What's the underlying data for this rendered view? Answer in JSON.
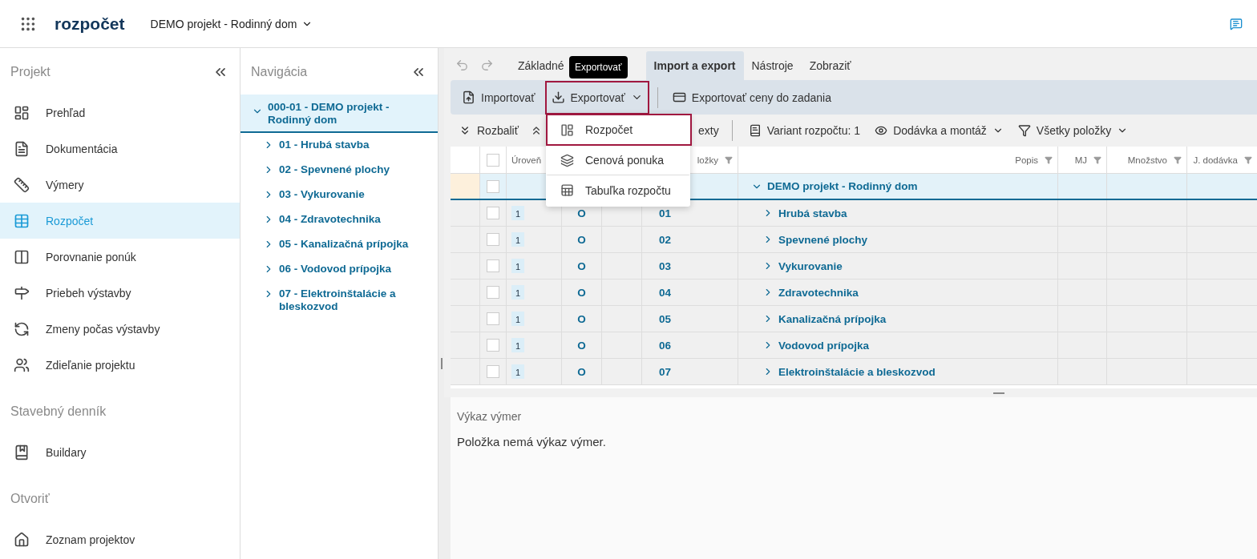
{
  "header": {
    "logo": "rozpočet",
    "project": "DEMO projekt - Rodinný dom"
  },
  "sidebar": {
    "sections": [
      {
        "title": "Projekt",
        "items": [
          {
            "label": "Prehľad",
            "selected": false
          },
          {
            "label": "Dokumentácia",
            "selected": false
          },
          {
            "label": "Výmery",
            "selected": false
          },
          {
            "label": "Rozpočet",
            "selected": true
          },
          {
            "label": "Porovnanie ponúk",
            "selected": false
          },
          {
            "label": "Priebeh výstavby",
            "selected": false
          },
          {
            "label": "Zmeny počas výstavby",
            "selected": false
          },
          {
            "label": "Zdieľanie projektu",
            "selected": false
          }
        ]
      },
      {
        "title": "Stavebný denník",
        "items": [
          {
            "label": "Buildary",
            "selected": false
          }
        ]
      },
      {
        "title": "Otvoriť",
        "items": [
          {
            "label": "Zoznam projektov",
            "selected": false
          }
        ]
      }
    ]
  },
  "navigation": {
    "title": "Navigácia",
    "tree": [
      {
        "label": "000-01 - DEMO projekt - Rodinný dom",
        "selected": true,
        "expanded": true,
        "children": [
          {
            "label": "01 - Hrubá stavba",
            "selected": false,
            "expanded": false
          },
          {
            "label": "02 - Spevnené plochy",
            "selected": false,
            "expanded": false
          },
          {
            "label": "03 - Vykurovanie",
            "selected": false,
            "expanded": false
          },
          {
            "label": "04 - Zdravotechnika",
            "selected": false,
            "expanded": false
          },
          {
            "label": "05 - Kanalizačná prípojka",
            "selected": false,
            "expanded": false
          },
          {
            "label": "06 - Vodovod prípojka",
            "selected": false,
            "expanded": false
          },
          {
            "label": "07 - Elektroinštalácie a bleskozvod",
            "selected": false,
            "expanded": false
          }
        ]
      }
    ]
  },
  "tabs": [
    {
      "label": "Základné",
      "selected": false
    },
    {
      "label": "Import a export",
      "selected": true
    },
    {
      "label": "Nástroje",
      "selected": false
    },
    {
      "label": "Zobraziť",
      "selected": false
    }
  ],
  "tooltip": "Exportovať",
  "ribbon": [
    {
      "label": "Importovať",
      "outlined": false,
      "dropdown": false
    },
    {
      "label": "Exportovať",
      "outlined": true,
      "dropdown": true
    },
    {
      "label": "Exportovať ceny do zadania",
      "outlined": false,
      "dropdown": false
    }
  ],
  "menu": [
    {
      "label": "Rozpočet",
      "outlined": true
    },
    {
      "label": "Cenová ponuka",
      "outlined": false
    },
    {
      "label": "Tabuľka rozpočtu",
      "outlined": false
    }
  ],
  "toolbar": [
    {
      "kind": "button",
      "label": "Rozbaliť",
      "dropdown": false
    },
    {
      "kind": "icon"
    },
    {
      "kind": "cut",
      "label": "exty"
    },
    {
      "kind": "button",
      "label": "Variant rozpočtu: 1",
      "dropdown": false
    },
    {
      "kind": "button",
      "label": "Dodávka a montáž",
      "dropdown": true
    },
    {
      "kind": "button",
      "label": "Všetky položky",
      "dropdown": true
    }
  ],
  "table": {
    "columns": [
      {
        "label": "Úroveň"
      },
      {
        "label": "ložky",
        "filter": true
      },
      {
        "label": "Popis",
        "filter": true
      },
      {
        "label": "MJ",
        "filter": true
      },
      {
        "label": "Množstvo",
        "filter": true
      },
      {
        "label": "J. dodávka",
        "filter": true
      }
    ],
    "all_checked": false,
    "root": {
      "description": "DEMO projekt - Rodinný dom",
      "expanded": true,
      "selected": true,
      "checked": false
    },
    "rows": [
      {
        "level": "1",
        "type": "O",
        "code": "01",
        "description": "Hrubá stavba",
        "checked": false,
        "expanded": false
      },
      {
        "level": "1",
        "type": "O",
        "code": "02",
        "description": "Spevnené plochy",
        "checked": false,
        "expanded": false
      },
      {
        "level": "1",
        "type": "O",
        "code": "03",
        "description": "Vykurovanie",
        "checked": false,
        "expanded": false
      },
      {
        "level": "1",
        "type": "O",
        "code": "04",
        "description": "Zdravotechnika",
        "checked": false,
        "expanded": false
      },
      {
        "level": "1",
        "type": "O",
        "code": "05",
        "description": "Kanalizačná prípojka",
        "checked": false,
        "expanded": false
      },
      {
        "level": "1",
        "type": "O",
        "code": "06",
        "description": "Vodovod prípojka",
        "checked": false,
        "expanded": false
      },
      {
        "level": "1",
        "type": "O",
        "code": "07",
        "description": "Elektroinštalácie a bleskozvod",
        "checked": false,
        "expanded": false
      }
    ]
  },
  "detail": {
    "title": "Výkaz výmer",
    "message": "Položka nemá výkaz výmer."
  }
}
